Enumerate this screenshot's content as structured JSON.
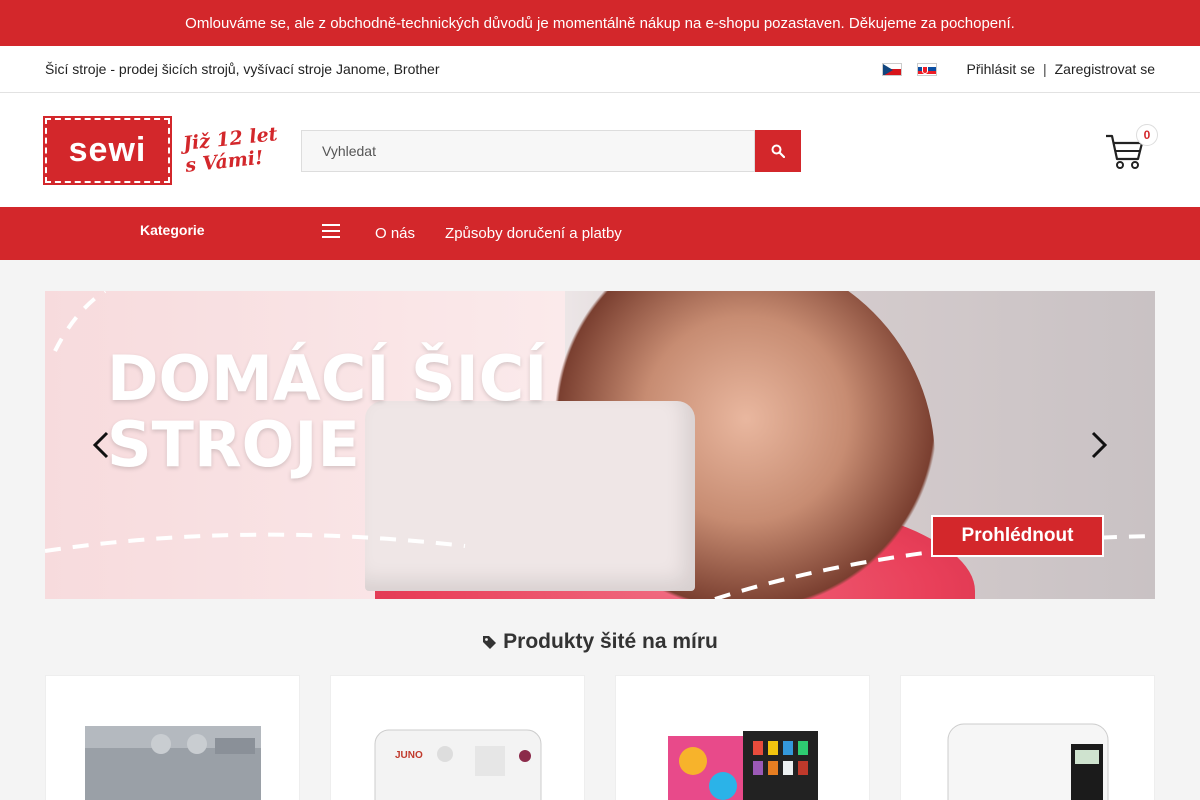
{
  "notice": "Omlouváme se, ale z obchodně-technických důvodů je momentálně nákup na e-shopu pozastaven. Děkujeme za pochopení.",
  "topbar": {
    "tagline": "Šicí stroje - prodej šicích strojů, vyšívací stroje Janome, Brother",
    "flags": [
      "cz-flag-icon",
      "sk-flag-icon"
    ],
    "login": "Přihlásit se",
    "separator": "|",
    "register": "Zaregistrovat se"
  },
  "header": {
    "logo": "sewi",
    "slogan_line1": "Již 12 let",
    "slogan_line2": "s Vámi!",
    "search_placeholder": "Vyhledat",
    "cart_count": "0"
  },
  "nav": {
    "categories": "Kategorie",
    "links": [
      "O nás",
      "Způsoby doručení a platby"
    ]
  },
  "banner": {
    "line1": "DOMÁCÍ ŠICÍ",
    "line2": "STROJE",
    "cta": "Prohlédnout"
  },
  "section": {
    "title": "Produkty šité na míru"
  },
  "colors": {
    "brand": "#d3272b",
    "background": "#f4f4f4"
  }
}
